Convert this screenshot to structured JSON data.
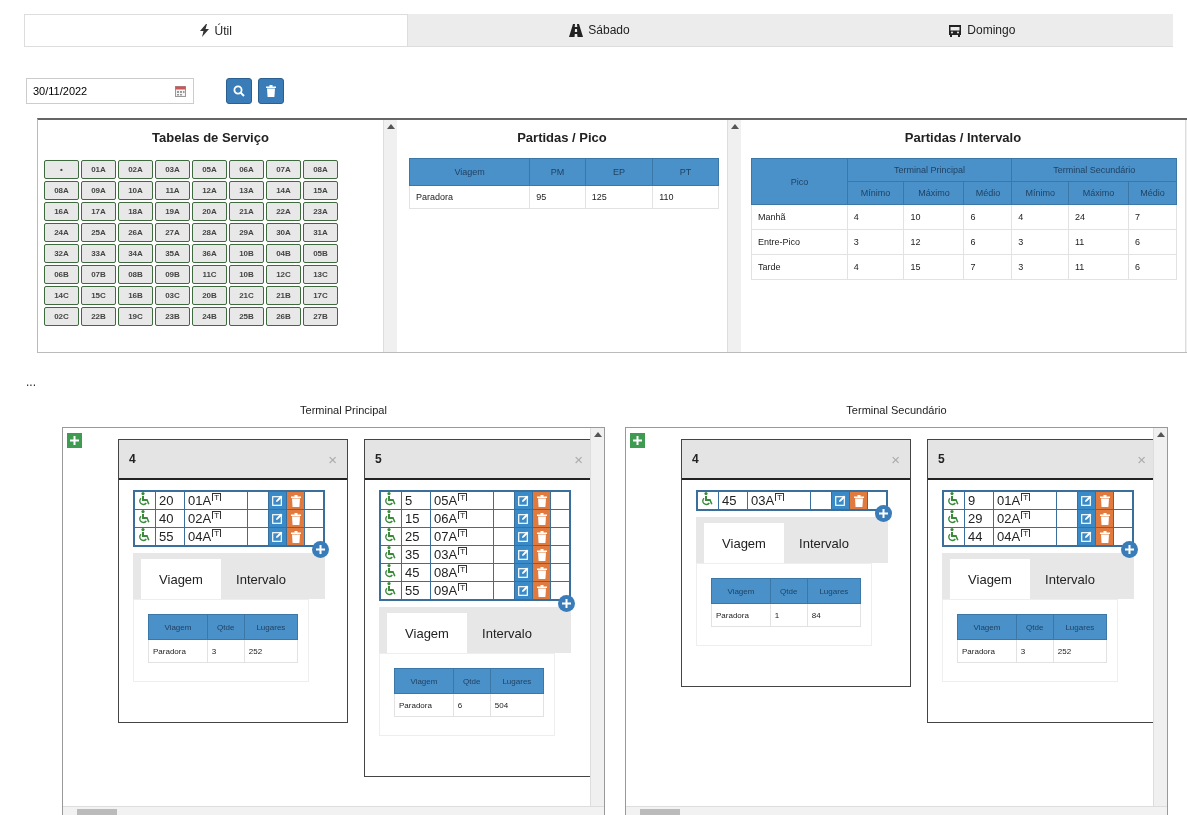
{
  "day_tabs": [
    {
      "label": "Útil",
      "selected": true
    },
    {
      "label": "Sábado",
      "selected": false
    },
    {
      "label": "Domingo",
      "selected": false
    }
  ],
  "date_field": {
    "value": "30/11/2022"
  },
  "service_tables": {
    "title": "Tabelas de Serviço",
    "items": [
      "•",
      "01A",
      "02A",
      "03A",
      "05A",
      "06A",
      "07A",
      "08A",
      "08A",
      "09A",
      "10A",
      "11A",
      "12A",
      "13A",
      "14A",
      "15A",
      "16A",
      "17A",
      "18A",
      "19A",
      "20A",
      "21A",
      "22A",
      "23A",
      "24A",
      "25A",
      "26A",
      "27A",
      "28A",
      "29A",
      "30A",
      "31A",
      "32A",
      "33A",
      "34A",
      "35A",
      "36A",
      "10B",
      "04B",
      "05B",
      "06B",
      "07B",
      "08B",
      "09B",
      "11C",
      "10B",
      "12C",
      "13C",
      "14C",
      "15C",
      "16B",
      "03C",
      "20B",
      "21C",
      "21B",
      "17C",
      "02C",
      "22B",
      "19C",
      "23B",
      "24B",
      "25B",
      "26B",
      "27B"
    ]
  },
  "departures_peak": {
    "title": "Partidas / Pico",
    "columns": [
      "Viagem",
      "PM",
      "EP",
      "PT"
    ],
    "rows": [
      [
        "Paradora",
        "95",
        "125",
        "110"
      ]
    ]
  },
  "departures_interval": {
    "title": "Partidas / Intervalo",
    "corner": "Pico",
    "groups": [
      "Terminal Principal",
      "Terminal Secundário"
    ],
    "subcolumns": [
      "Mínimo",
      "Máximo",
      "Médio",
      "Mínimo",
      "Máximo",
      "Médio"
    ],
    "rows": [
      [
        "Manhã",
        "4",
        "10",
        "6",
        "4",
        "24",
        "7"
      ],
      [
        "Entre-Pico",
        "3",
        "12",
        "6",
        "3",
        "11",
        "6"
      ],
      [
        "Tarde",
        "4",
        "15",
        "7",
        "3",
        "11",
        "6"
      ]
    ]
  },
  "ellipsis": "...",
  "terminals": [
    {
      "title": "Terminal Principal",
      "cards": [
        {
          "title": "4",
          "close": "×",
          "slots": [
            {
              "number": "20",
              "code": "01A",
              "badge": "T"
            },
            {
              "number": "40",
              "code": "02A",
              "badge": "T"
            },
            {
              "number": "55",
              "code": "04A",
              "badge": "T"
            }
          ],
          "tabs": [
            {
              "label": "Viagem",
              "selected": true
            },
            {
              "label": "Intervalo",
              "selected": false
            }
          ],
          "table": {
            "columns": [
              "Viagem",
              "Qtde",
              "Lugares"
            ],
            "rows": [
              [
                "Paradora",
                "3",
                "252"
              ]
            ]
          }
        },
        {
          "title": "5",
          "close": "×",
          "slots": [
            {
              "number": "5",
              "code": "05A",
              "badge": "T"
            },
            {
              "number": "15",
              "code": "06A",
              "badge": "T"
            },
            {
              "number": "25",
              "code": "07A",
              "badge": "T"
            },
            {
              "number": "35",
              "code": "03A",
              "badge": "T"
            },
            {
              "number": "45",
              "code": "08A",
              "badge": "T"
            },
            {
              "number": "55",
              "code": "09A",
              "badge": "T"
            }
          ],
          "tabs": [
            {
              "label": "Viagem",
              "selected": true
            },
            {
              "label": "Intervalo",
              "selected": false
            }
          ],
          "table": {
            "columns": [
              "Viagem",
              "Qtde",
              "Lugares"
            ],
            "rows": [
              [
                "Paradora",
                "6",
                "504"
              ]
            ]
          }
        }
      ]
    },
    {
      "title": "Terminal Secundário",
      "cards": [
        {
          "title": "4",
          "close": "×",
          "slots": [
            {
              "number": "45",
              "code": "03A",
              "badge": "T"
            }
          ],
          "tabs": [
            {
              "label": "Viagem",
              "selected": true
            },
            {
              "label": "Intervalo",
              "selected": false
            }
          ],
          "table": {
            "columns": [
              "Viagem",
              "Qtde",
              "Lugares"
            ],
            "rows": [
              [
                "Paradora",
                "1",
                "84"
              ]
            ]
          }
        },
        {
          "title": "5",
          "close": "×",
          "slots": [
            {
              "number": "9",
              "code": "01A",
              "badge": "T"
            },
            {
              "number": "29",
              "code": "02A",
              "badge": "T"
            },
            {
              "number": "44",
              "code": "04A",
              "badge": "T"
            }
          ],
          "tabs": [
            {
              "label": "Viagem",
              "selected": true
            },
            {
              "label": "Intervalo",
              "selected": false
            }
          ],
          "table": {
            "columns": [
              "Viagem",
              "Qtde",
              "Lugares"
            ],
            "rows": [
              [
                "Paradora",
                "3",
                "252"
              ]
            ]
          }
        }
      ]
    }
  ]
}
